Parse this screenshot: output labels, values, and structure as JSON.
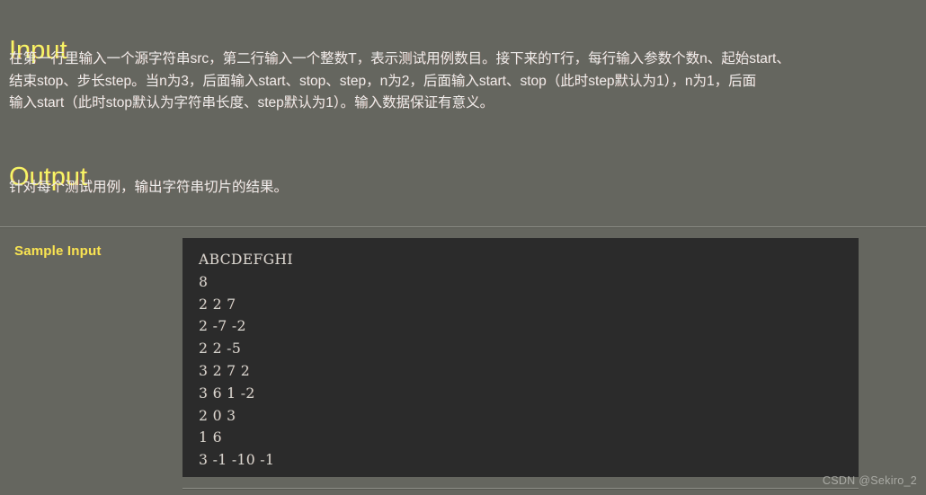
{
  "page": {
    "background_color": "#65665f",
    "heading_color": "#f5f566",
    "body_text_color": "#ececeb",
    "code_background_color": "#2b2b2b",
    "code_text_color": "#d6d6d0"
  },
  "sections": {
    "input": {
      "heading": "Input",
      "lines": [
        "在第一行里输入一个源字符串src，第二行输入一个整数T，表示测试用例数目。接下来的T行，每行输入参数个数n、起始start、",
        "结束stop、步长step。当n为3，后面输入start、stop、step，n为2，后面输入start、stop（此时step默认为1），n为1，后面",
        "输入start（此时stop默认为字符串长度、step默认为1）。输入数据保证有意义。"
      ]
    },
    "output": {
      "heading": "Output",
      "lines": [
        "针对每个测试用例，输出字符串切片的结果。"
      ]
    },
    "sample_input": {
      "label": "Sample Input",
      "code_lines": [
        "ABCDEFGHI",
        "8",
        "2 2 7",
        "2 -7 -2",
        "2 2 -5",
        "3 2 7 2",
        "3 6 1 -2",
        "2 0 3",
        "1 6",
        "3 -1 -10 -1"
      ]
    }
  },
  "watermark": {
    "text": "CSDN @Sekiro_2"
  }
}
